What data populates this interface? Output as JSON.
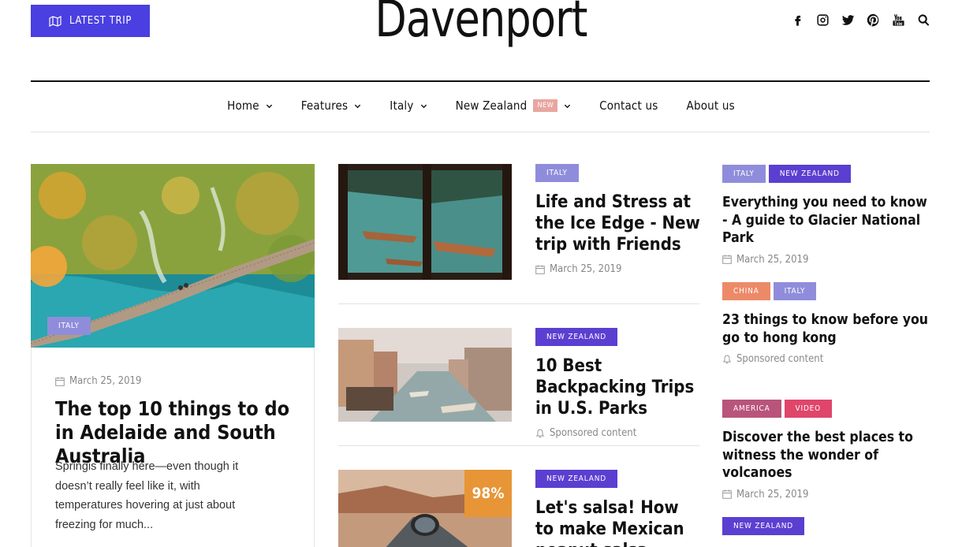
{
  "header": {
    "latest_trip_label": "LATEST TRIP",
    "brand": "Davenport",
    "social_icons": [
      "facebook-icon",
      "instagram-icon",
      "twitter-icon",
      "pinterest-icon",
      "youtube-icon",
      "search-icon"
    ]
  },
  "nav": {
    "items": [
      {
        "label": "Home",
        "dropdown": true
      },
      {
        "label": "Features",
        "dropdown": true
      },
      {
        "label": "Italy",
        "dropdown": true
      },
      {
        "label": "New Zealand",
        "badge": "NEW",
        "dropdown": true
      },
      {
        "label": "Contact us",
        "dropdown": false
      },
      {
        "label": "About us",
        "dropdown": false
      }
    ]
  },
  "colors": {
    "accent": "#4a3fe0",
    "tag_italy": "#8f8ddb",
    "tag_new_zealand": "#5b3fd1",
    "tag_china": "#ec8a68",
    "tag_america": "#b9547a",
    "tag_video": "#e0456a",
    "badge_new": "#e9a6a0",
    "score": "#e79536"
  },
  "feature": {
    "tag": "ITALY",
    "date": "March 25, 2019",
    "title": "The top 10 things to do in Adelaide and South Australia",
    "excerpt": "Springis finally here—even though it doesn’t really feel like it, with temperatures hovering at just about freezing for much..."
  },
  "middle": [
    {
      "tag": "ITALY",
      "title": "Life and Stress at the Ice Edge - New trip with Friends",
      "meta": "March 25, 2019",
      "meta_icon": "calendar-icon"
    },
    {
      "tag": "NEW ZEALAND",
      "title": "10 Best Backpacking Trips in U.S. Parks",
      "meta": "Sponsored content",
      "meta_icon": "bell-icon"
    },
    {
      "tag": "NEW ZEALAND",
      "title": "Let's salsa! How to make Mexican peanut salsa",
      "score": "98%"
    }
  ],
  "right": [
    {
      "tags": [
        "ITALY",
        "NEW ZEALAND"
      ],
      "title": "Everything you need to know - A guide to Glacier National Park",
      "meta": "March 25, 2019",
      "meta_icon": "calendar-icon"
    },
    {
      "tags": [
        "CHINA",
        "ITALY"
      ],
      "title": "23 things to know before you go to hong kong",
      "meta": "Sponsored content",
      "meta_icon": "bell-icon"
    },
    {
      "tags": [
        "AMERICA",
        "VIDEO"
      ],
      "title": "Discover the best places to witness the wonder of volcanoes",
      "meta": "March 25, 2019",
      "meta_icon": "calendar-icon"
    },
    {
      "tags": [
        "NEW ZEALAND"
      ]
    }
  ]
}
